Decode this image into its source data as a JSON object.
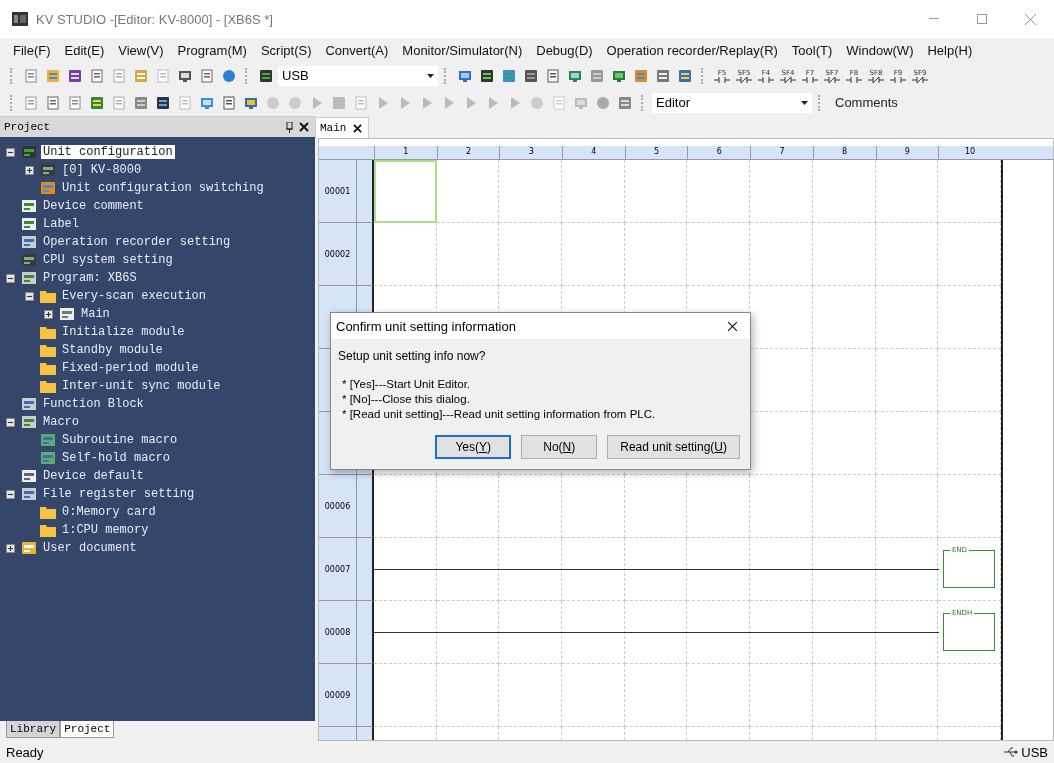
{
  "window": {
    "title": "KV STUDIO -[Editor: KV-8000] - [XB6S *]"
  },
  "menu": [
    "File(F)",
    "Edit(E)",
    "View(V)",
    "Program(M)",
    "Script(S)",
    "Convert(A)",
    "Monitor/Simulator(N)",
    "Debug(D)",
    "Operation recorder/Replay(R)",
    "Tool(T)",
    "Window(W)",
    "Help(H)"
  ],
  "toolbar": {
    "connection": "USB",
    "function_keys": [
      "F5",
      "SF5",
      "F4",
      "SF4",
      "F7",
      "SF7",
      "F8",
      "SF8",
      "F9",
      "SF9"
    ],
    "mode": "Editor",
    "comments": "Comments"
  },
  "project_panel": {
    "title": "Project",
    "tree": [
      {
        "label": "Unit configuration",
        "kind": "unit",
        "selected": true,
        "expanded": true,
        "children": [
          {
            "label": "[0]  KV-8000",
            "kind": "cpu",
            "selected": false,
            "expanded": false
          },
          {
            "label": "Unit configuration switching",
            "kind": "switch",
            "selected": false
          }
        ]
      },
      {
        "label": "Device comment",
        "kind": "comment",
        "selected": false
      },
      {
        "label": "Label",
        "kind": "comment",
        "selected": false
      },
      {
        "label": "Operation recorder setting",
        "kind": "recorder",
        "selected": false
      },
      {
        "label": "CPU system setting",
        "kind": "cpu",
        "selected": false
      },
      {
        "label": "Program: XB6S",
        "kind": "program",
        "selected": false,
        "expanded": true,
        "children": [
          {
            "label": "Every-scan execution",
            "kind": "folder",
            "selected": false,
            "expanded": true,
            "children": [
              {
                "label": "Main",
                "kind": "doc",
                "selected": false,
                "expanded": false
              }
            ]
          },
          {
            "label": "Initialize module",
            "kind": "folder",
            "selected": false
          },
          {
            "label": "Standby module",
            "kind": "folder",
            "selected": false
          },
          {
            "label": "Fixed-period module",
            "kind": "folder",
            "selected": false
          },
          {
            "label": "Inter-unit sync module",
            "kind": "folder",
            "selected": false
          }
        ]
      },
      {
        "label": "Function Block",
        "kind": "recorder",
        "selected": false
      },
      {
        "label": "Macro",
        "kind": "macro",
        "selected": false,
        "expanded": true,
        "children": [
          {
            "label": "Subroutine macro",
            "kind": "macroitem",
            "selected": false
          },
          {
            "label": "Self-hold macro",
            "kind": "macroitem",
            "selected": false
          }
        ]
      },
      {
        "label": "Device default",
        "kind": "grid",
        "selected": false
      },
      {
        "label": "File register setting",
        "kind": "recorder",
        "selected": false,
        "expanded": true,
        "children": [
          {
            "label": "0:Memory card",
            "kind": "folder",
            "selected": false
          },
          {
            "label": "1:CPU memory",
            "kind": "folder",
            "selected": false
          }
        ]
      },
      {
        "label": "User document",
        "kind": "userdoc",
        "selected": false,
        "expanded": false
      }
    ],
    "tabs": [
      {
        "label": "Library",
        "selected": false
      },
      {
        "label": "Project",
        "selected": true
      }
    ]
  },
  "editor": {
    "tab": "Main",
    "columns": [
      "1",
      "2",
      "3",
      "4",
      "5",
      "6",
      "7",
      "8",
      "9",
      "10"
    ],
    "rows": [
      {
        "number": "00001",
        "selected": true
      },
      {
        "number": "00002",
        "selected": false
      },
      {},
      {},
      {},
      {
        "number": "00006",
        "selected": false
      },
      {
        "number": "00007",
        "selected": false,
        "instruction": "END"
      },
      {
        "number": "00008",
        "selected": false,
        "instruction": "ENDH"
      },
      {
        "number": "00009",
        "selected": false
      },
      {
        "selected": false
      }
    ]
  },
  "dialog": {
    "title": "Confirm unit setting information",
    "question": "Setup unit setting info now?",
    "notes": [
      "* [Yes]---Start Unit Editor.",
      "* [No]---Close this dialog.",
      "* [Read unit setting]---Read unit setting information from PLC."
    ],
    "buttons": [
      {
        "label": "Yes(Y)",
        "selected": true
      },
      {
        "label": "No(N)",
        "selected": false
      },
      {
        "label": "Read unit setting(U)",
        "selected": false
      }
    ]
  },
  "status_bar": {
    "text": "Ready",
    "connection": "USB"
  }
}
